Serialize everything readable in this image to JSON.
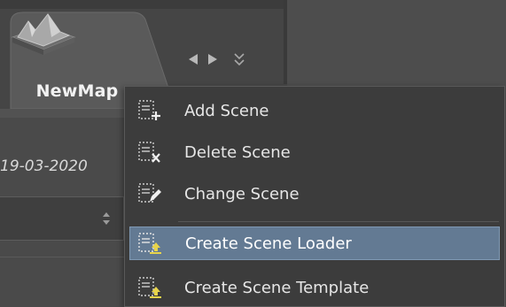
{
  "tab": {
    "label": "NewMap",
    "icon": "map-terrain-icon"
  },
  "nav": {
    "prev_icon": "arrow-left-icon",
    "next_icon": "arrow-right-icon",
    "more_icon": "chevron-double-down-icon"
  },
  "left_panel": {
    "date": "19-03-2020"
  },
  "menu": {
    "items": [
      {
        "label": "Add Scene",
        "icon": "add-scene-icon"
      },
      {
        "label": "Delete Scene",
        "icon": "delete-scene-icon"
      },
      {
        "label": "Change Scene",
        "icon": "change-scene-icon"
      },
      {
        "label": "Create Scene Loader",
        "icon": "scene-loader-icon",
        "selected": true
      },
      {
        "label": "Create Scene Template",
        "icon": "scene-template-icon"
      }
    ]
  },
  "colors": {
    "highlight": "#637a93",
    "menu_bg": "#3c3c3c",
    "accent_yellow": "#e8d44a"
  }
}
